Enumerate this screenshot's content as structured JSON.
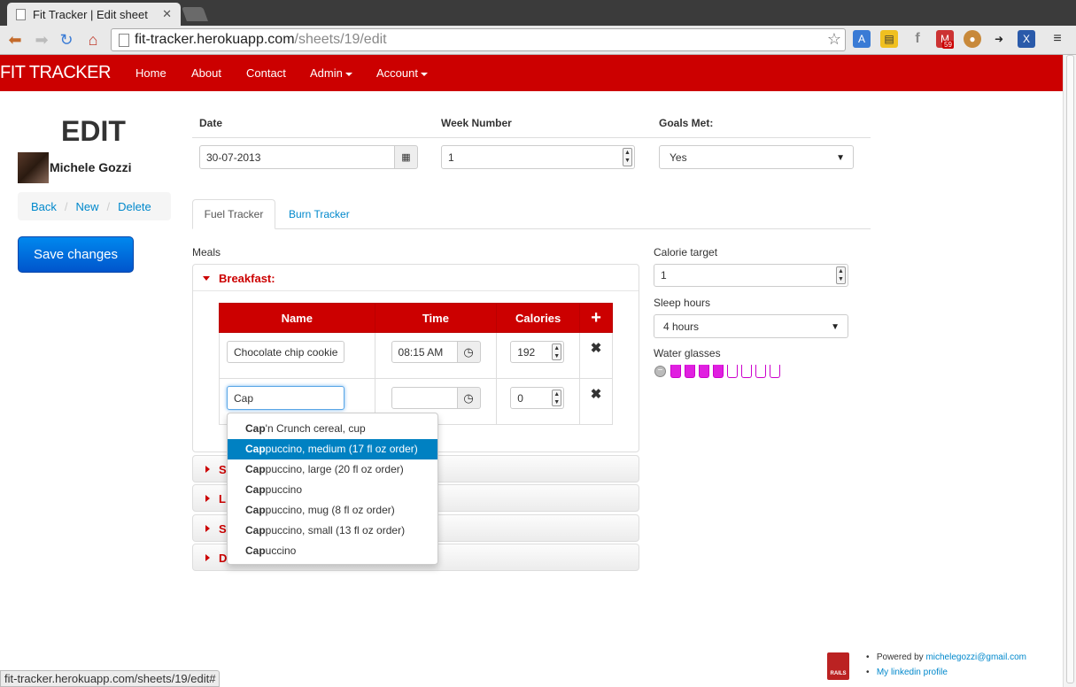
{
  "browser": {
    "tab_title": "Fit Tracker | Edit sheet",
    "url_host": "fit-tracker.herokuapp.com",
    "url_path": "/sheets/19/edit",
    "gmail_count": "59",
    "status_bar": "fit-tracker.herokuapp.com/sheets/19/edit#"
  },
  "navbar": {
    "brand": "FIT TRACKER",
    "items": [
      "Home",
      "About",
      "Contact",
      "Admin",
      "Account"
    ]
  },
  "sidebar": {
    "title": "EDIT",
    "user_name": "Michele Gozzi",
    "breadcrumb": [
      "Back",
      "New",
      "Delete"
    ],
    "save_label": "Save changes"
  },
  "form": {
    "date_label": "Date",
    "date_value": "30-07-2013",
    "week_label": "Week Number",
    "week_value": "1",
    "goals_label": "Goals Met:",
    "goals_value": "Yes"
  },
  "tabs": [
    "Fuel Tracker",
    "Burn Tracker"
  ],
  "meals": {
    "label": "Meals",
    "breakfast_title": "Breakfast:",
    "columns": [
      "Name",
      "Time",
      "Calories"
    ],
    "add_symbol": "+",
    "rows": [
      {
        "name": "Chocolate chip cookie",
        "time": "08:15 AM",
        "calories": "192"
      },
      {
        "name": "Cap",
        "time": "",
        "calories": "0"
      }
    ],
    "collapsed_initials": [
      "S",
      "L",
      "S",
      "D"
    ]
  },
  "autocomplete": {
    "query": "Cap",
    "items": [
      {
        "match": "Cap",
        "rest": "'n Crunch cereal, cup"
      },
      {
        "match": "Cap",
        "rest": "puccino, medium (17 fl oz order)"
      },
      {
        "match": "Cap",
        "rest": "puccino, large (20 fl oz order)"
      },
      {
        "match": "Cap",
        "rest": "puccino"
      },
      {
        "match": "Cap",
        "rest": "puccino, mug (8 fl oz order)"
      },
      {
        "match": "Cap",
        "rest": "puccino, small (13 fl oz order)"
      },
      {
        "match": "Cap",
        "rest": "uccino"
      }
    ],
    "active_index": 1
  },
  "right_panel": {
    "calorie_label": "Calorie target",
    "calorie_value": "1",
    "sleep_label": "Sleep hours",
    "sleep_value": "4 hours",
    "water_label": "Water glasses",
    "water_filled": 4,
    "water_total": 8
  },
  "footer": {
    "powered_prefix": "Powered by ",
    "email": "michelegozzi@gmail.com",
    "linkedin": "My linkedin profile",
    "rails_badge": "RAILS"
  },
  "colors": {
    "brand_red": "#cc0000",
    "link_blue": "#0088cc",
    "water_magenta": "#e020e0"
  }
}
